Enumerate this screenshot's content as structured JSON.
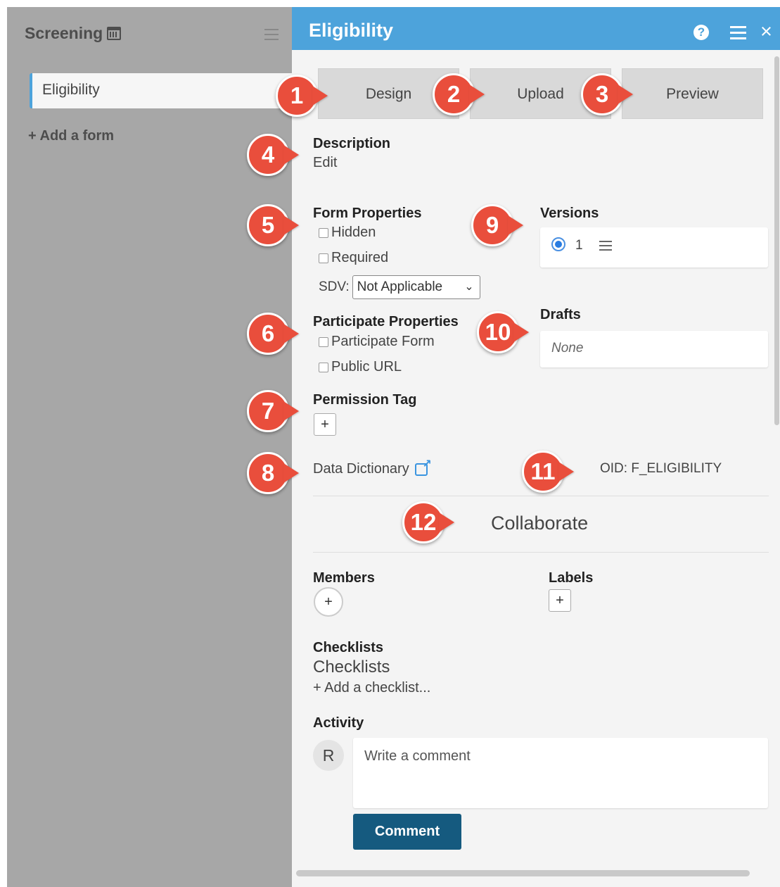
{
  "sidebar": {
    "title": "Screening",
    "forms": [
      {
        "label": "Eligibility"
      }
    ],
    "add_form": "+ Add a form"
  },
  "header": {
    "title": "Eligibility"
  },
  "tabs": [
    {
      "label": "Design"
    },
    {
      "label": "Upload"
    },
    {
      "label": "Preview"
    }
  ],
  "description": {
    "heading": "Description",
    "edit": "Edit"
  },
  "form_properties": {
    "heading": "Form Properties",
    "hidden": "Hidden",
    "required": "Required",
    "sdv_label": "SDV:",
    "sdv_value": "Not Applicable"
  },
  "versions": {
    "heading": "Versions",
    "items": [
      {
        "number": "1",
        "selected": true
      }
    ]
  },
  "participate_properties": {
    "heading": "Participate Properties",
    "participate_form": "Participate Form",
    "public_url": "Public URL"
  },
  "drafts": {
    "heading": "Drafts",
    "empty": "None"
  },
  "permission_tag": {
    "heading": "Permission Tag",
    "add": "+"
  },
  "data_dictionary": "Data Dictionary",
  "oid": "OID: F_ELIGIBILITY",
  "collaborate": "Collaborate",
  "members": {
    "heading": "Members",
    "add": "+"
  },
  "labels": {
    "heading": "Labels",
    "add": "+"
  },
  "checklists": {
    "heading": "Checklists",
    "subheading": "Checklists",
    "add": "+ Add a checklist..."
  },
  "activity": {
    "heading": "Activity",
    "avatar": "R",
    "placeholder": "Write a comment",
    "button": "Comment"
  },
  "callouts": [
    "1",
    "2",
    "3",
    "4",
    "5",
    "6",
    "7",
    "8",
    "9",
    "10",
    "11",
    "12"
  ],
  "colors": {
    "header": "#4da3db",
    "sidebar": "#a7a7a7",
    "callout": "#e94e3c",
    "comment_button": "#155a7f"
  }
}
